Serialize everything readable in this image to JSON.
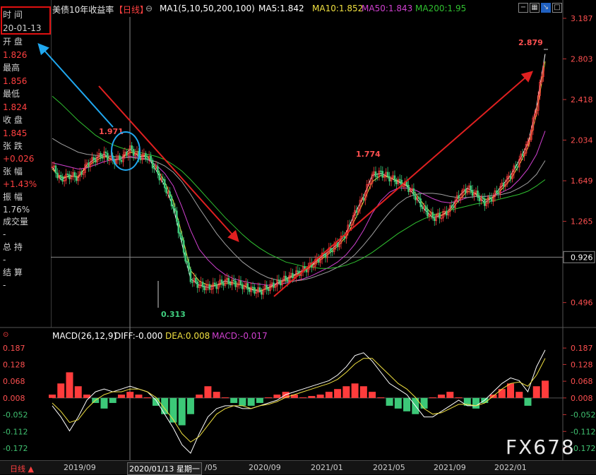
{
  "info_panel": {
    "time_label": "时 间",
    "time_value": "20-01-13",
    "open_label": "开 盘",
    "open_value": "1.826",
    "high_label": "最高",
    "high_value": "1.856",
    "low_label": "最低",
    "low_value": "1.824",
    "close_label": "收 盘",
    "close_value": "1.845",
    "change_label": "张 跌",
    "change_value": "+0.026",
    "pct_label": "张 幅",
    "pct_value": "+1.43%",
    "amp_label": "振 幅",
    "amp_value": "1.76%",
    "vol_label": "成交量",
    "vol_value": "-",
    "hold_label": "总 持",
    "hold_value": "-",
    "settle_label": "结 算",
    "settle_value": "-"
  },
  "header": {
    "title": "美债10年收益率",
    "period": "【日线】",
    "ma_legend": "MA1(5,10,50,200,100)",
    "ma5": "MA5:1.842",
    "ma10": "MA10:1.852",
    "ma50": "MA50:1.843",
    "ma200": "MA200:1.95",
    "settings_icon": "⊖"
  },
  "macd_header": {
    "title": "MACD(26,12,9)",
    "diff": "DIFF:-0.000",
    "dea": "DEA:0.008",
    "macd": "MACD:-0.017"
  },
  "bottom_bar": {
    "period_tab": "日线 ▲",
    "cursor_date": "2020/01/13 星期一",
    "x_ticks": [
      "2019/09",
      "/05",
      "2020/09",
      "2021/01",
      "2021/05",
      "2021/09",
      "2022/01"
    ]
  },
  "watermark": "FX678",
  "colors": {
    "up": "#ff3c3c",
    "down": "#3cc878",
    "ma5": "#ffffff",
    "ma10": "#f0e040",
    "ma50": "#d040d0",
    "ma200": "#30c030",
    "ma100": "#a0a0a0",
    "annotation_red": "#e02020",
    "annotation_blue": "#20a8f0"
  },
  "chart_data": [
    {
      "type": "candlestick",
      "title": "美债10年收益率",
      "y_ticks": [
        "3.187",
        "2.803",
        "2.418",
        "2.034",
        "1.649",
        "1.265",
        "0.926",
        "0.496"
      ],
      "ylim": [
        0.3,
        3.2
      ],
      "crosshair_value": "0.926",
      "annotations": [
        {
          "label": "1.971",
          "value": 1.971
        },
        {
          "label": "1.774",
          "value": 1.774
        },
        {
          "label": "2.879",
          "value": 2.879
        },
        {
          "label": "0.313",
          "value": 0.313
        }
      ],
      "series": [
        {
          "name": "MA5",
          "values": [
            1.78,
            1.66,
            1.7,
            1.68,
            1.8,
            1.86,
            1.9,
            1.84,
            1.86,
            1.95,
            1.88,
            1.88,
            1.75,
            1.6,
            1.4,
            1.05,
            0.72,
            0.66,
            0.64,
            0.66,
            0.7,
            0.68,
            0.66,
            0.62,
            0.6,
            0.64,
            0.68,
            0.72,
            0.76,
            0.8,
            0.85,
            0.92,
            0.98,
            1.05,
            1.16,
            1.34,
            1.5,
            1.7,
            1.72,
            1.68,
            1.64,
            1.6,
            1.5,
            1.38,
            1.3,
            1.32,
            1.38,
            1.5,
            1.58,
            1.52,
            1.44,
            1.5,
            1.6,
            1.7,
            1.84,
            2.0,
            2.35,
            2.85
          ]
        },
        {
          "name": "MA10",
          "values": [
            1.76,
            1.68,
            1.69,
            1.69,
            1.78,
            1.84,
            1.88,
            1.85,
            1.86,
            1.92,
            1.9,
            1.88,
            1.78,
            1.64,
            1.46,
            1.14,
            0.8,
            0.7,
            0.66,
            0.66,
            0.68,
            0.68,
            0.66,
            0.63,
            0.61,
            0.63,
            0.67,
            0.71,
            0.75,
            0.79,
            0.84,
            0.9,
            0.96,
            1.03,
            1.12,
            1.28,
            1.45,
            1.64,
            1.7,
            1.68,
            1.65,
            1.61,
            1.53,
            1.42,
            1.33,
            1.32,
            1.36,
            1.46,
            1.55,
            1.53,
            1.47,
            1.49,
            1.57,
            1.66,
            1.8,
            1.96,
            2.28,
            2.78
          ]
        },
        {
          "name": "MA50",
          "values": [
            1.82,
            1.8,
            1.78,
            1.76,
            1.77,
            1.8,
            1.83,
            1.85,
            1.86,
            1.88,
            1.87,
            1.85,
            1.8,
            1.72,
            1.6,
            1.4,
            1.18,
            1.0,
            0.9,
            0.82,
            0.76,
            0.72,
            0.7,
            0.68,
            0.67,
            0.66,
            0.67,
            0.68,
            0.7,
            0.72,
            0.75,
            0.79,
            0.83,
            0.88,
            0.95,
            1.05,
            1.18,
            1.34,
            1.46,
            1.54,
            1.58,
            1.58,
            1.56,
            1.52,
            1.48,
            1.45,
            1.44,
            1.46,
            1.49,
            1.5,
            1.5,
            1.51,
            1.54,
            1.58,
            1.66,
            1.76,
            1.9,
            2.12
          ]
        },
        {
          "name": "MA100",
          "values": [
            2.05,
            2.0,
            1.96,
            1.92,
            1.9,
            1.89,
            1.88,
            1.88,
            1.87,
            1.87,
            1.86,
            1.85,
            1.83,
            1.79,
            1.73,
            1.64,
            1.52,
            1.39,
            1.27,
            1.15,
            1.05,
            0.96,
            0.88,
            0.82,
            0.77,
            0.73,
            0.71,
            0.7,
            0.7,
            0.71,
            0.73,
            0.76,
            0.79,
            0.83,
            0.88,
            0.95,
            1.04,
            1.14,
            1.25,
            1.35,
            1.43,
            1.49,
            1.52,
            1.53,
            1.53,
            1.52,
            1.5,
            1.49,
            1.49,
            1.5,
            1.5,
            1.51,
            1.52,
            1.54,
            1.58,
            1.63,
            1.71,
            1.84
          ]
        },
        {
          "name": "MA200",
          "values": [
            2.45,
            2.38,
            2.3,
            2.22,
            2.15,
            2.08,
            2.03,
            1.99,
            1.96,
            1.94,
            1.92,
            1.9,
            1.88,
            1.85,
            1.8,
            1.74,
            1.66,
            1.57,
            1.48,
            1.39,
            1.3,
            1.22,
            1.14,
            1.07,
            1.01,
            0.96,
            0.92,
            0.88,
            0.86,
            0.84,
            0.83,
            0.82,
            0.82,
            0.83,
            0.85,
            0.88,
            0.92,
            0.97,
            1.03,
            1.09,
            1.15,
            1.2,
            1.25,
            1.29,
            1.32,
            1.35,
            1.37,
            1.39,
            1.41,
            1.43,
            1.44,
            1.46,
            1.48,
            1.5,
            1.52,
            1.55,
            1.6,
            1.66
          ]
        }
      ]
    },
    {
      "type": "bar",
      "title": "MACD(26,12,9)",
      "y_ticks": [
        "0.187",
        "0.128",
        "0.068",
        "0.008",
        "-0.052",
        "-0.112",
        "-0.172"
      ],
      "ylim": [
        -0.205,
        0.205
      ],
      "values": [
        0.02,
        0.06,
        0.1,
        0.05,
        0.02,
        -0.01,
        -0.03,
        -0.01,
        0.02,
        0.03,
        0.02,
        0.01,
        -0.02,
        -0.05,
        -0.08,
        -0.09,
        -0.05,
        0.02,
        0.05,
        0.03,
        0.01,
        -0.01,
        -0.02,
        -0.02,
        -0.01,
        0.01,
        0.02,
        0.03,
        0.02,
        0.01,
        0.015,
        0.02,
        0.03,
        0.04,
        0.05,
        0.06,
        0.05,
        0.03,
        0.01,
        -0.02,
        -0.03,
        -0.04,
        -0.05,
        -0.03,
        0.01,
        0.02,
        0.03,
        0.01,
        -0.02,
        -0.03,
        -0.01,
        0.02,
        0.04,
        0.06,
        0.03,
        -0.02,
        0.05,
        0.07
      ],
      "series": [
        {
          "name": "DIFF",
          "values": [
            -0.02,
            -0.06,
            -0.11,
            -0.06,
            0.0,
            0.03,
            0.04,
            0.03,
            0.04,
            0.05,
            0.04,
            0.03,
            0.0,
            -0.05,
            -0.1,
            -0.16,
            -0.19,
            -0.12,
            -0.06,
            -0.03,
            -0.02,
            -0.02,
            -0.03,
            -0.03,
            -0.02,
            -0.01,
            0.0,
            0.02,
            0.03,
            0.04,
            0.05,
            0.06,
            0.07,
            0.09,
            0.12,
            0.16,
            0.17,
            0.14,
            0.1,
            0.06,
            0.04,
            0.02,
            -0.02,
            -0.06,
            -0.06,
            -0.04,
            -0.02,
            0.0,
            -0.02,
            -0.02,
            0.0,
            0.03,
            0.06,
            0.08,
            0.07,
            0.03,
            0.12,
            0.18
          ]
        },
        {
          "name": "DEA",
          "values": [
            -0.01,
            -0.04,
            -0.08,
            -0.07,
            -0.03,
            0.0,
            0.02,
            0.03,
            0.03,
            0.04,
            0.04,
            0.03,
            0.01,
            -0.03,
            -0.07,
            -0.12,
            -0.15,
            -0.13,
            -0.09,
            -0.05,
            -0.03,
            -0.02,
            -0.02,
            -0.03,
            -0.02,
            -0.015,
            -0.005,
            0.01,
            0.02,
            0.03,
            0.04,
            0.05,
            0.06,
            0.075,
            0.1,
            0.13,
            0.15,
            0.15,
            0.12,
            0.09,
            0.06,
            0.04,
            0.01,
            -0.03,
            -0.05,
            -0.045,
            -0.03,
            -0.015,
            -0.015,
            -0.02,
            -0.01,
            0.015,
            0.04,
            0.06,
            0.065,
            0.05,
            0.09,
            0.15
          ]
        }
      ]
    }
  ]
}
